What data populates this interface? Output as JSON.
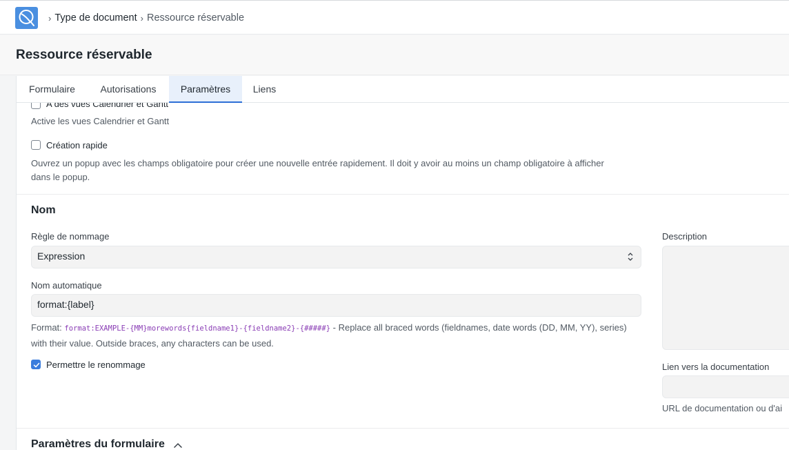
{
  "breadcrumb": {
    "items": [
      "Type de document",
      "Ressource réservable"
    ]
  },
  "page": {
    "title": "Ressource réservable"
  },
  "tabs": [
    {
      "label": "Formulaire",
      "active": false
    },
    {
      "label": "Autorisations",
      "active": false
    },
    {
      "label": "Paramètres",
      "active": true
    },
    {
      "label": "Liens",
      "active": false
    }
  ],
  "view_settings": {
    "calendar_gantt": {
      "label": "A des vues Calendrier et Gantt",
      "checked": false,
      "description": "Active les vues Calendrier et Gantt"
    },
    "quick_entry": {
      "label": "Création rapide",
      "checked": false,
      "description": "Ouvrez un popup avec les champs obligatoire pour créer une nouvelle entrée rapidement. Il doit y avoir au moins un champ obligatoire à afficher dans le popup."
    }
  },
  "naming": {
    "section_title": "Nom",
    "rule_label": "Règle de nommage",
    "rule_value": "Expression",
    "autoname_label": "Nom automatique",
    "autoname_value": "format:{label}",
    "format_prefix": "Format: ",
    "format_code": "format:EXAMPLE-{MM}morewords{fieldname1}-{fieldname2}-{#####}",
    "format_help": " - Replace all braced words (fieldnames, date words (DD, MM, YY), series) with their value. Outside braces, any characters can be used.",
    "allow_rename_label": "Permettre le renommage",
    "allow_rename_checked": true,
    "description_label": "Description",
    "description_value": "",
    "doc_link_label": "Lien vers la documentation",
    "doc_link_value": "",
    "doc_link_help": "URL de documentation ou d'ai"
  },
  "form_settings": {
    "section_title": "Paramètres du formulaire"
  },
  "colors": {
    "accent": "#2d6fd6",
    "checkbox_checked": "#3b7ddd",
    "logo": "#4a8fe0",
    "code": "#8a3db5"
  }
}
